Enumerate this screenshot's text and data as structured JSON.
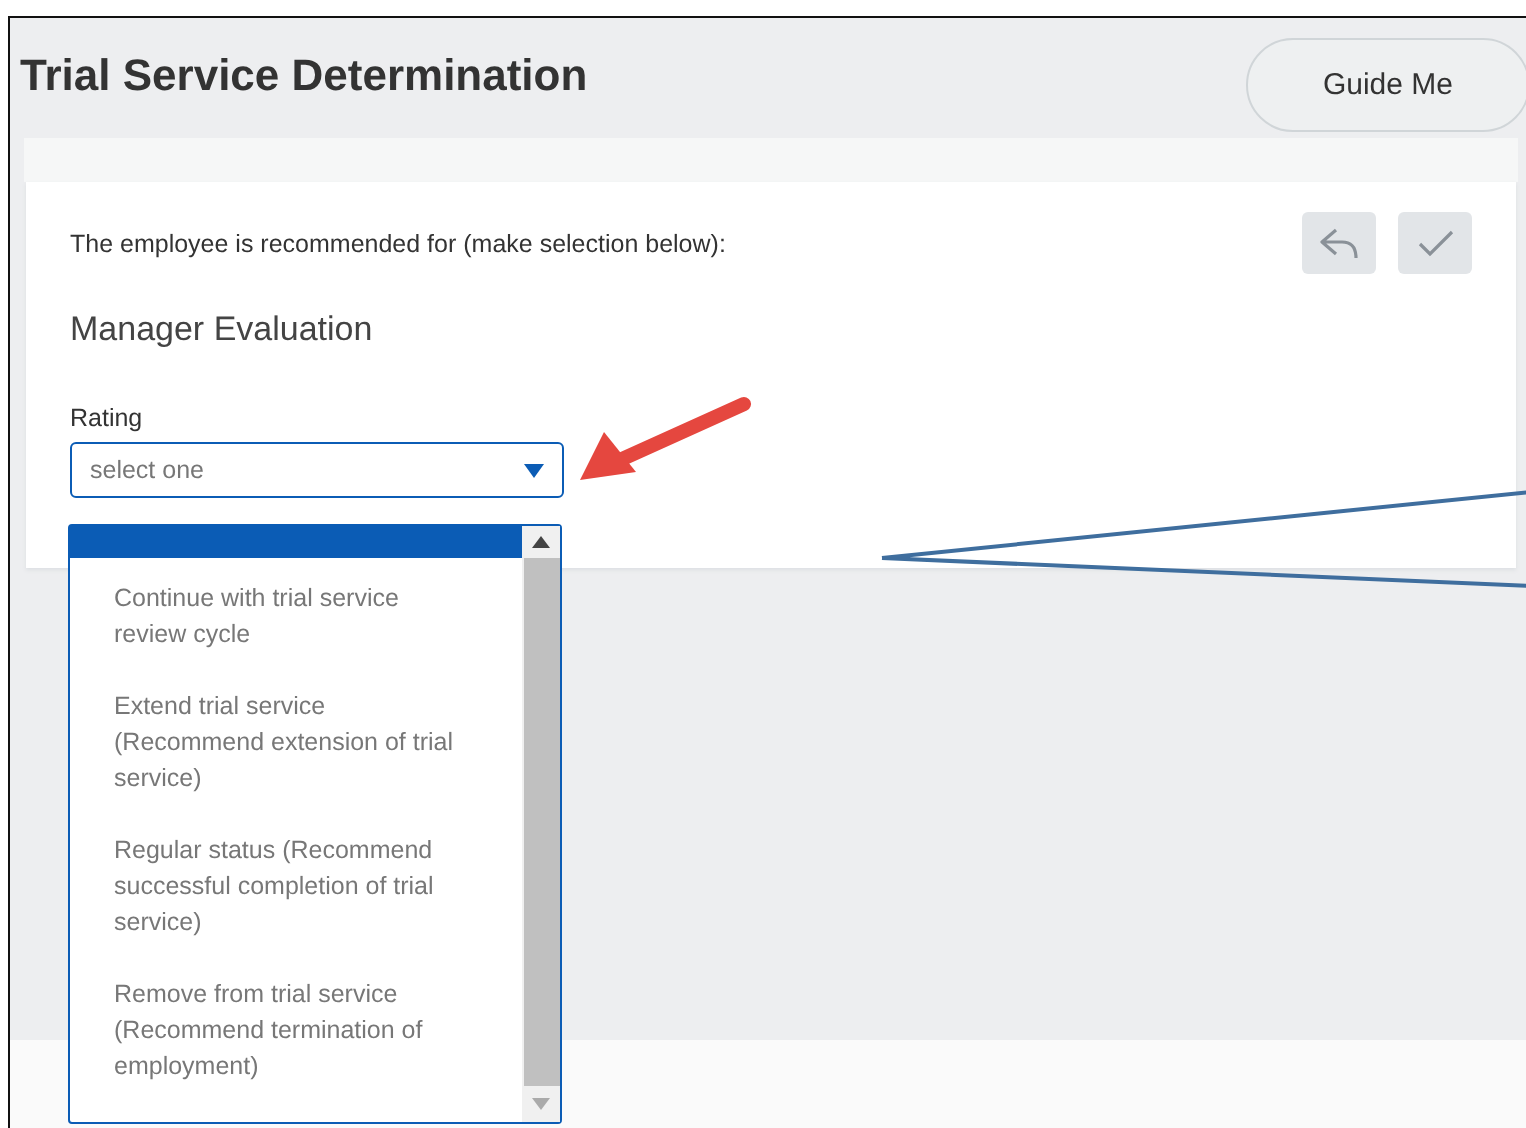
{
  "page": {
    "title": "Trial Service Determination",
    "guide_button": "Guide Me"
  },
  "card": {
    "instruction": "The employee is recommended for (make selection below):",
    "section_title": "Manager Evaluation",
    "field_label": "Rating",
    "select_placeholder": "select one"
  },
  "dropdown": {
    "blank_row_highlighted": true,
    "options": [
      {
        "label": "Continue with trial service review cycle",
        "selected": false
      },
      {
        "label": "Extend trial service (Recommend extension of trial service)",
        "selected": false
      },
      {
        "label": "Regular status (Recommend successful completion of trial service)",
        "selected": false
      },
      {
        "label": "Remove from trial service (Recommend termination of employment)",
        "selected": false
      }
    ]
  }
}
